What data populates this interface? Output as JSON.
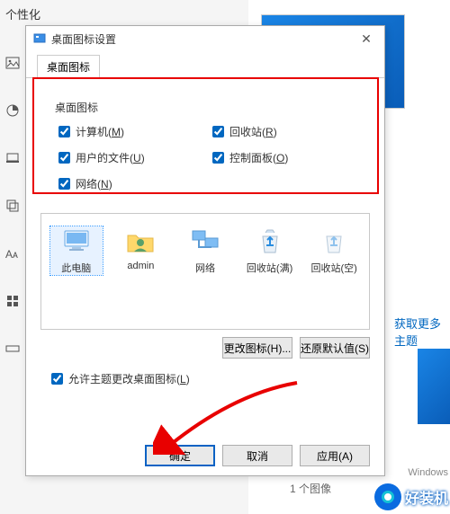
{
  "bg": {
    "header": "个性化",
    "theme_link": "获取更多主题",
    "image_count": "1 个图像",
    "windows_label": "Windows"
  },
  "dialog": {
    "title": "桌面图标设置",
    "tab": "桌面图标",
    "group_label": "桌面图标",
    "checks": {
      "computer": {
        "label": "计算机",
        "hotkey": "M",
        "checked": true
      },
      "recycle": {
        "label": "回收站",
        "hotkey": "R",
        "checked": true
      },
      "userfiles": {
        "label": "用户的文件",
        "hotkey": "U",
        "checked": true
      },
      "cpanel": {
        "label": "控制面板",
        "hotkey": "O",
        "checked": true
      },
      "network": {
        "label": "网络",
        "hotkey": "N",
        "checked": true
      }
    },
    "icons": {
      "thispc": "此电脑",
      "admin": "admin",
      "network": "网络",
      "recycle_full": "回收站(满)",
      "recycle_empty": "回收站(空)"
    },
    "buttons": {
      "change_icon": "更改图标(H)...",
      "restore_default": "还原默认值(S)",
      "ok": "确定",
      "cancel": "取消",
      "apply": "应用(A)"
    },
    "allow_theme": {
      "label": "允许主题更改桌面图标",
      "hotkey": "L",
      "checked": true
    }
  },
  "watermark": {
    "text": "好装机"
  }
}
